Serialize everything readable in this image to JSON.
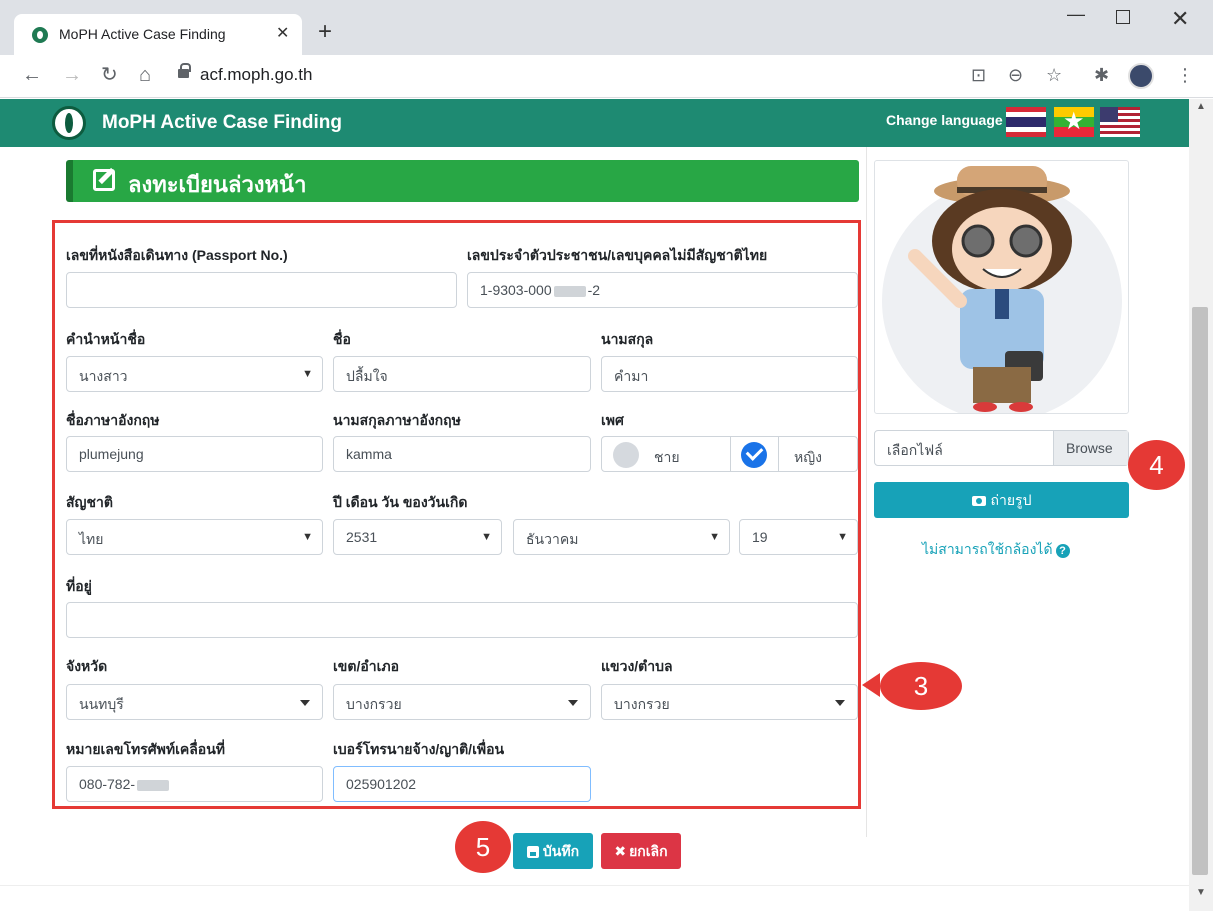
{
  "browser": {
    "tab_title": "MoPH Active Case Finding",
    "tab_close": "✕",
    "new_tab": "+",
    "url": "acf.moph.go.th",
    "minimize": "—",
    "close": "✕"
  },
  "navbar": {
    "brand": "MoPH Active Case Finding",
    "change_language": "Change language"
  },
  "header": {
    "title": "ลงทะเบียนล่วงหน้า"
  },
  "form": {
    "passport_label": "เลขที่หนังสือเดินทาง (Passport No.)",
    "passport_value": "",
    "id_label": "เลขประจำตัวประชาชน/เลขบุคคลไม่มีสัญชาติไทย",
    "id_value_prefix": "1-9303-000",
    "id_value_suffix": "-2",
    "prefix_label": "คำนำหน้าชื่อ",
    "prefix_value": "นางสาว",
    "firstname_label": "ชื่อ",
    "firstname_value": "ปลื้มใจ",
    "lastname_label": "นามสกุล",
    "lastname_value": "คำมา",
    "en_firstname_label": "ชื่อภาษาอังกฤษ",
    "en_firstname_value": "plumejung",
    "en_lastname_label": "นามสกุลภาษาอังกฤษ",
    "en_lastname_value": "kamma",
    "gender_label": "เพศ",
    "gender_male": "ชาย",
    "gender_female": "หญิง",
    "nationality_label": "สัญชาติ",
    "nationality_value": "ไทย",
    "dob_label": "ปี เดือน วัน ของวันเกิด",
    "dob_year": "2531",
    "dob_month": "ธันวาคม",
    "dob_day": "19",
    "address_label": "ที่อยู่",
    "address_value": "",
    "province_label": "จังหวัด",
    "province_value": "นนทบุรี",
    "district_label": "เขต/อำเภอ",
    "district_value": "บางกรวย",
    "subdistrict_label": "แขวง/ตำบล",
    "subdistrict_value": "บางกรวย",
    "mobile_label": "หมายเลขโทรศัพท์เคลื่อนที่",
    "mobile_value_prefix": "080-782-",
    "contact_phone_label": "เบอร์โทรนายจ้าง/ญาติ/เพื่อน",
    "contact_phone_value": "025901202"
  },
  "photo": {
    "file_placeholder": "เลือกไฟล์",
    "browse": "Browse",
    "take_photo": "ถ่ายรูป",
    "camera_help": "ไม่สามารถใช้กล้องได้"
  },
  "actions": {
    "save": "บันทึก",
    "cancel": "ยกเลิก"
  },
  "callouts": {
    "step3": "3",
    "step4": "4",
    "step5": "5"
  },
  "colors": {
    "navbar": "#1e8a72",
    "header": "#28a745",
    "info": "#17a2b8",
    "danger": "#dc3545",
    "callout": "#e53935"
  }
}
